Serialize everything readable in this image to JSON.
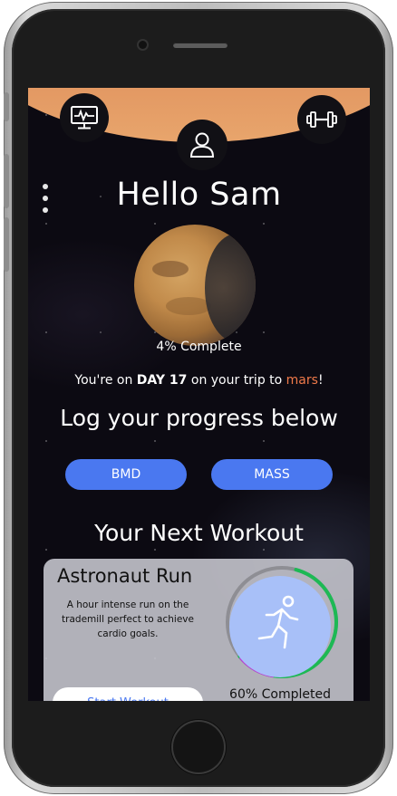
{
  "header": {
    "monitor_icon": "monitor-icon",
    "profile_icon": "profile-icon",
    "dumbbell_icon": "dumbbell-icon",
    "menu_icon": "more-vertical-icon"
  },
  "greeting": "Hello Sam",
  "progress": {
    "complete_text": "4% Complete",
    "trip_prefix": "You're on ",
    "day_text": "DAY 17",
    "trip_middle": " on your trip to ",
    "destination": "mars",
    "trip_suffix": "!"
  },
  "log": {
    "heading": "Log your progress below",
    "buttons": [
      "BMD",
      "MASS"
    ]
  },
  "workout": {
    "heading": "Your Next Workout",
    "title": "Astronaut Run",
    "description": "A hour intense run on the trademill perfect to achieve cardio goals.",
    "start_label": "Start Workout",
    "completed_text": "60% Completed",
    "completed_fraction": 0.6,
    "icon": "runner-icon"
  },
  "colors": {
    "accent_blue": "#4a78f0",
    "mars_orange": "#f07a4a",
    "ring_green": "#1db954",
    "ring_purple": "#c03ad8"
  }
}
